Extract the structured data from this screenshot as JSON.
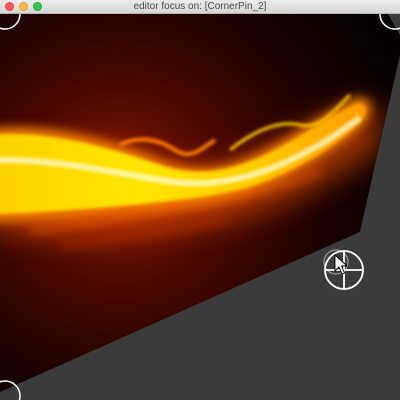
{
  "window": {
    "title": "editor focus on: [CornerPin_2]"
  },
  "viewport": {
    "background_color": "#3a3a3a",
    "content": "fire-streak-image",
    "handles": [
      "corner-pin-handle-top-left",
      "corner-pin-handle-top-right",
      "corner-pin-handle-bottom-left",
      "corner-pin-handle-center"
    ]
  },
  "icons": {
    "cursor": "arrow-cursor-icon",
    "crosshair": "crosshair-handle-icon"
  },
  "colors": {
    "handle_stroke": "#ffffff",
    "flame_core": "#ffee00",
    "flame_glow": "#ff6a00"
  }
}
